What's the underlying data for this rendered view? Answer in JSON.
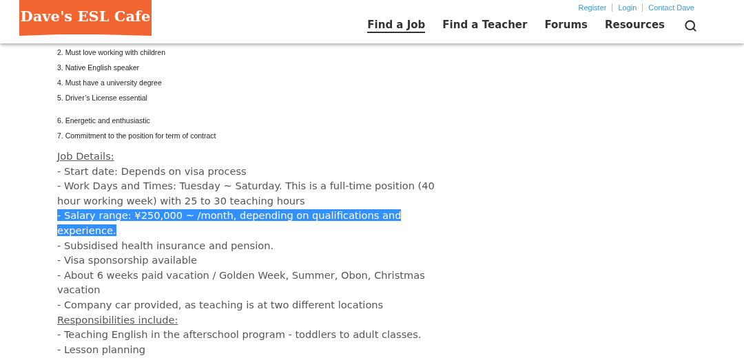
{
  "header": {
    "logo": "Dave's ESL Cafe",
    "top_links": [
      "Register",
      "Login",
      "Contact Dave"
    ],
    "nav": [
      {
        "label": "Find a Job",
        "selected": true
      },
      {
        "label": "Find a Teacher",
        "selected": false
      },
      {
        "label": "Forums",
        "selected": false
      },
      {
        "label": "Resources",
        "selected": false
      }
    ]
  },
  "requirement_groups": [
    [
      "2. Must love working with children",
      "3. Native English speaker",
      "4. Must have a university degree",
      "5. Driver’s License essential"
    ],
    [
      "6. Energetic and enthusiastic",
      "7. Commitment to the position for term of contract"
    ]
  ],
  "details": [
    {
      "kind": "heading",
      "text": "Job Details:"
    },
    {
      "kind": "item",
      "text": "- Start date: Depends on visa process"
    },
    {
      "kind": "item",
      "text": "- Work Days and Times: Tuesday ~ Saturday. This is a full-time position (40 hour working week) with 25 to 30 teaching hours"
    },
    {
      "kind": "item",
      "text": "- Salary range: ¥250,000 ~ /month, depending on qualifications and experience.",
      "highlighted": true
    },
    {
      "kind": "item",
      "text": "- Subsidised health insurance and pension."
    },
    {
      "kind": "item",
      "text": "- Visa sponsorship available"
    },
    {
      "kind": "item",
      "text": "- About 6 weeks paid vacation / Golden Week, Summer, Obon, Christmas vacation"
    },
    {
      "kind": "item",
      "text": "- Company car provided, as teaching is at two different locations"
    },
    {
      "kind": "heading",
      "text": "Responsibilities include: "
    },
    {
      "kind": "item",
      "text": "- Teaching English in the afterschool program - toddlers to adult classes."
    },
    {
      "kind": "item",
      "text": "- Lesson planning"
    }
  ]
}
